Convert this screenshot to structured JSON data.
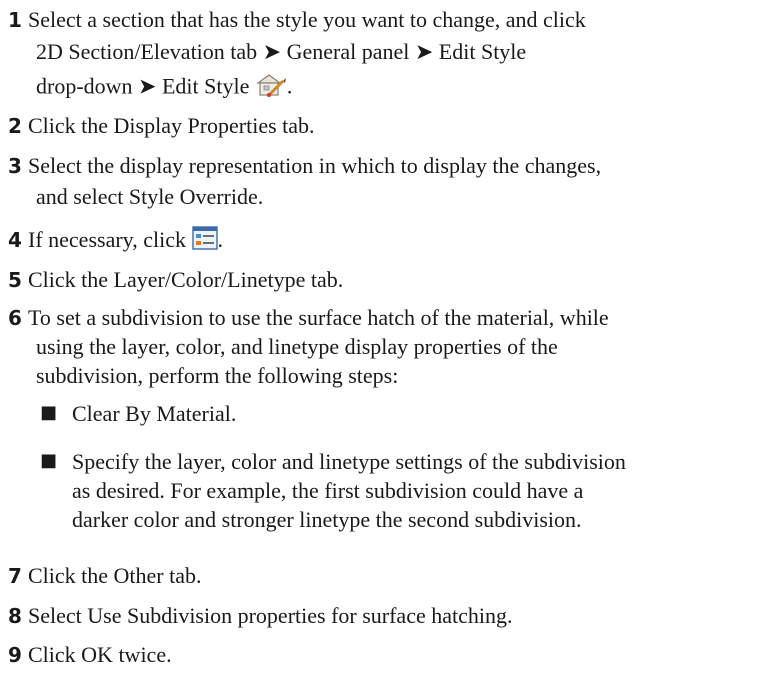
{
  "steps": [
    {
      "num": "1",
      "lines": [
        "Select a section that has the style you want to change, and click",
        "2D Section/Elevation tab ➤ General panel ➤ Edit Style",
        "drop-down ➤ Edit Style"
      ],
      "suffix": "."
    },
    {
      "num": "2",
      "lines": [
        "Click the Display Properties tab."
      ]
    },
    {
      "num": "3",
      "lines": [
        "Select the display representation in which to display the changes,",
        "and select Style Override."
      ]
    },
    {
      "num": "4",
      "lines": [
        "If necessary, click"
      ],
      "suffix": "."
    },
    {
      "num": "5",
      "lines": [
        "Click the Layer/Color/Linetype tab."
      ]
    },
    {
      "num": "6",
      "lines": [
        "To set a subdivision to use the surface hatch of the material, while",
        "using the layer, color, and linetype display properties of the",
        "subdivision, perform the following steps:"
      ],
      "bullets": [
        [
          "Clear By Material."
        ],
        [
          "Specify the layer, color and linetype settings of the subdivision",
          "as desired. For example, the first subdivision could have a",
          "darker color and stronger linetype the second subdivision."
        ]
      ]
    },
    {
      "num": "7",
      "lines": [
        "Click the Other tab."
      ]
    },
    {
      "num": "8",
      "lines": [
        "Select Use Subdivision properties for surface hatching."
      ]
    },
    {
      "num": "9",
      "lines": [
        "Click OK twice."
      ]
    }
  ],
  "bullet_glyph": "■",
  "icons": [
    "edit-style-icon",
    "display-properties-icon"
  ]
}
